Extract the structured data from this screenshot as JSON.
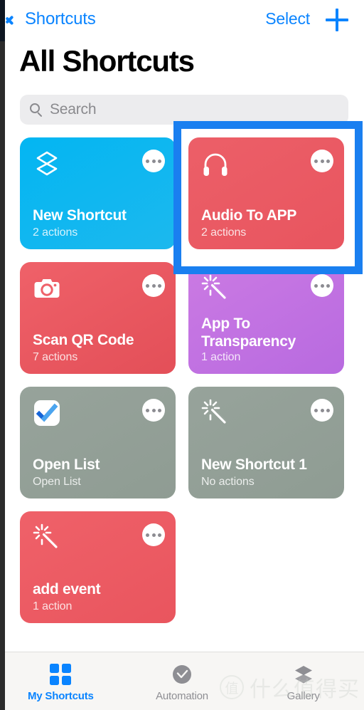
{
  "nav": {
    "back_label": "Shortcuts",
    "back_icon": "chevron-left-icon",
    "select_label": "Select",
    "add_icon": "plus-icon"
  },
  "page_title": "All Shortcuts",
  "search": {
    "placeholder": "Search",
    "value": "",
    "icon": "search-icon"
  },
  "highlight": {
    "target": "Audio To APP",
    "color": "#1a7ff0"
  },
  "shortcuts": [
    {
      "title": "New Shortcut",
      "subtitle": "2 actions",
      "icon": "layers-stack-icon",
      "color": "#03b6f2",
      "color_end": "#1cb8ee",
      "menu_icon": "ellipsis-icon",
      "highlighted": false
    },
    {
      "title": "Audio To APP",
      "subtitle": "2 actions",
      "icon": "headphones-icon",
      "color": "#ec5f68",
      "color_end": "#e8555f",
      "menu_icon": "ellipsis-icon",
      "highlighted": true
    },
    {
      "title": "Scan QR Code",
      "subtitle": "7 actions",
      "icon": "camera-icon",
      "color": "#ef6169",
      "color_end": "#e34f58",
      "menu_icon": "ellipsis-icon",
      "highlighted": false
    },
    {
      "title": "App To Transparency",
      "subtitle": "1 action",
      "icon": "magic-wand-icon",
      "color": "#cb7ae3",
      "color_end": "#b86ae0",
      "menu_icon": "ellipsis-icon",
      "highlighted": false
    },
    {
      "title": "Open List",
      "subtitle": "Open List",
      "icon": "todo-check-app-icon",
      "color": "#97a39b",
      "color_end": "#8f9c93",
      "menu_icon": "ellipsis-icon",
      "highlighted": false
    },
    {
      "title": "New Shortcut 1",
      "subtitle": "No actions",
      "icon": "magic-wand-icon",
      "color": "#97a39b",
      "color_end": "#8f9c93",
      "menu_icon": "ellipsis-icon",
      "highlighted": false
    },
    {
      "title": "add event",
      "subtitle": "1 action",
      "icon": "magic-wand-icon",
      "color": "#ef6169",
      "color_end": "#e9555e",
      "menu_icon": "ellipsis-icon",
      "highlighted": false
    }
  ],
  "tabs": [
    {
      "label": "My Shortcuts",
      "icon": "grid-squares-icon",
      "active": true
    },
    {
      "label": "Automation",
      "icon": "clock-check-icon",
      "active": false
    },
    {
      "label": "Gallery",
      "icon": "layers-stack-icon",
      "active": false
    }
  ],
  "watermark": {
    "badge": "值",
    "text": "什么值得买"
  }
}
